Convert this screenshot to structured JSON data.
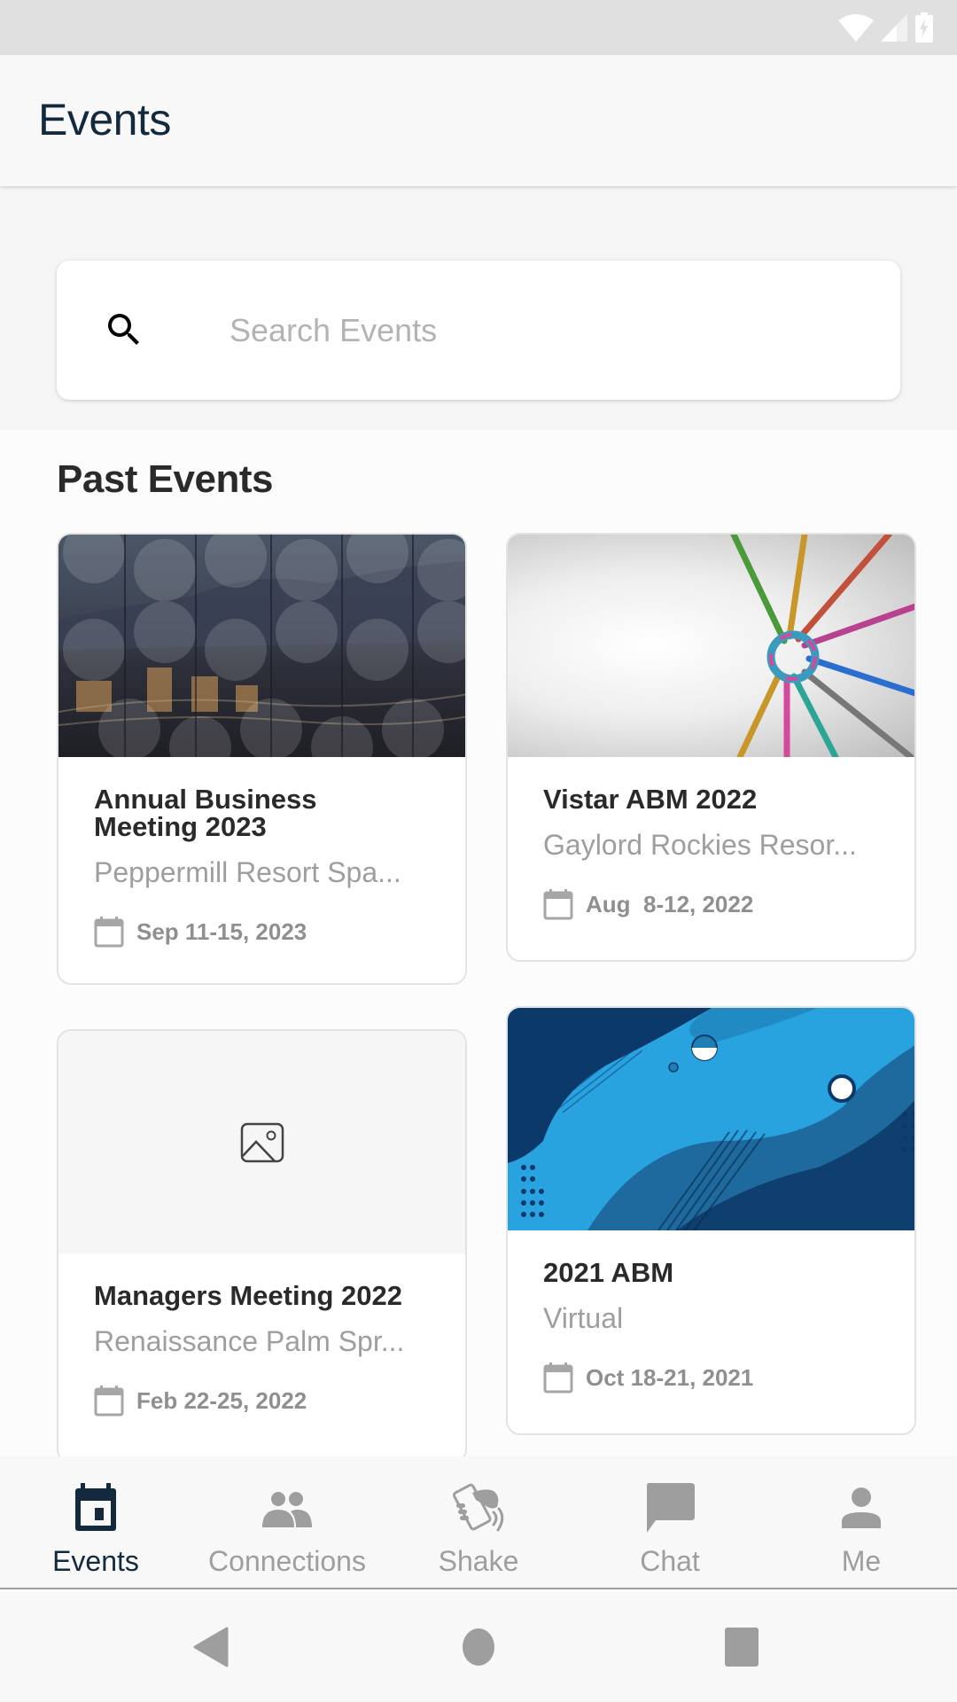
{
  "status_bar": {
    "icons": [
      "wifi-icon",
      "cellular-signal-icon",
      "battery-charging-icon"
    ]
  },
  "header": {
    "title": "Events"
  },
  "search": {
    "placeholder": "Search Events",
    "value": "",
    "icon": "search-icon"
  },
  "section": {
    "title": "Past Events"
  },
  "events": [
    {
      "title": "Annual Business Meeting 2023",
      "location": "Peppermill Resort Spa...",
      "date": "Sep 11-15, 2023",
      "image": "city-night-skyline-with-circle-pattern"
    },
    {
      "title": "Vistar ABM 2022",
      "location": "Gaylord Rockies Resor...",
      "date": "Aug  8-12, 2022",
      "image": "colorful-ropes-knotted-ring"
    },
    {
      "title": "Managers Meeting 2022",
      "location": "Renaissance Palm Spr...",
      "date": "Feb 22-25, 2022",
      "image": "image-placeholder"
    },
    {
      "title": "2021 ABM",
      "location": "Virtual",
      "date": "Oct 18-21, 2021",
      "image": "blue-abstract-waves"
    }
  ],
  "bottom_nav": {
    "active": "Events",
    "items": [
      {
        "label": "Events",
        "icon": "calendar-icon"
      },
      {
        "label": "Connections",
        "icon": "people-icon"
      },
      {
        "label": "Shake",
        "icon": "shake-phone-icon"
      },
      {
        "label": "Chat",
        "icon": "chat-bubble-icon"
      },
      {
        "label": "Me",
        "icon": "person-icon"
      }
    ]
  },
  "system_nav": {
    "buttons": [
      "back",
      "home",
      "recents"
    ]
  },
  "colors": {
    "primary": "#13293d",
    "inactive": "#9e9e9e",
    "title_text": "#2a2a2a",
    "secondary_text": "#9e9e9e"
  }
}
